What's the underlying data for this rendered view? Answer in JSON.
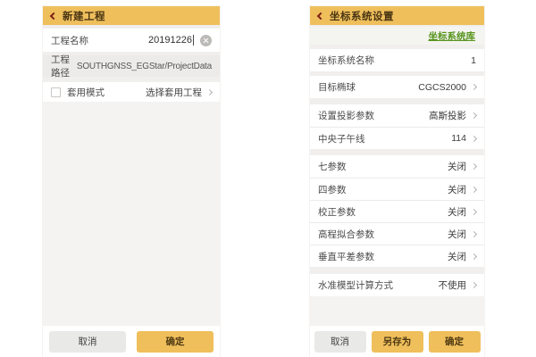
{
  "app": {
    "accent_color": "#EFBF5C",
    "link_color": "#57941D"
  },
  "left_screen": {
    "title": "新建工程",
    "fields": {
      "name_label": "工程名称",
      "name_value": "20191226",
      "path_label": "工程路径",
      "path_value": "SOUTHGNSS_EGStar/ProjectData",
      "apply_label": "套用模式",
      "apply_action": "选择套用工程"
    },
    "buttons": {
      "cancel": "取消",
      "ok": "确定"
    }
  },
  "right_screen": {
    "title": "坐标系统设置",
    "library_link": "坐标系统库",
    "rows": [
      {
        "label": "坐标系统名称",
        "value": "1"
      },
      {
        "label": "目标椭球",
        "value": "CGCS2000"
      },
      {
        "label": "设置投影参数",
        "value": "高斯投影"
      },
      {
        "label": "中央子午线",
        "value": "114"
      },
      {
        "label": "七参数",
        "value": "关闭"
      },
      {
        "label": "四参数",
        "value": "关闭"
      },
      {
        "label": "校正参数",
        "value": "关闭"
      },
      {
        "label": "高程拟合参数",
        "value": "关闭"
      },
      {
        "label": "垂直平差参数",
        "value": "关闭"
      },
      {
        "label": "水准模型计算方式",
        "value": "不使用"
      }
    ],
    "buttons": {
      "cancel": "取消",
      "save_as": "另存为",
      "ok": "确定"
    }
  }
}
